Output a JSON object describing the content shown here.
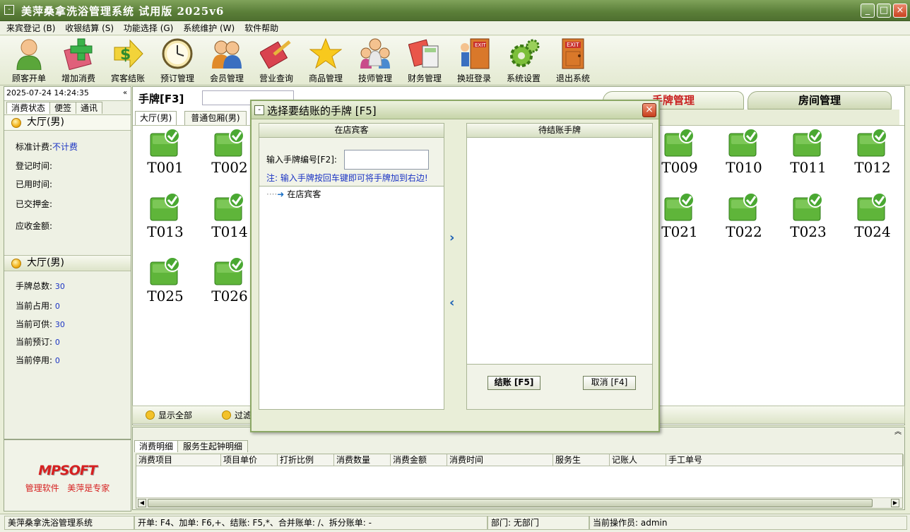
{
  "window": {
    "title": "美萍桑拿洗浴管理系统 试用版 2025v6",
    "buttons": [
      "_",
      "□",
      "×"
    ]
  },
  "menu": [
    "来宾登记 (B)",
    "收银结算 (S)",
    "功能选择 (G)",
    "系统维护 (W)",
    "软件帮助"
  ],
  "toolbar": [
    {
      "label": "顾客开单",
      "icon": "person-icon"
    },
    {
      "label": "增加消费",
      "icon": "add-gift-icon"
    },
    {
      "label": "宾客结账",
      "icon": "dollar-arrow-icon"
    },
    {
      "label": "预订管理",
      "icon": "clock-icon"
    },
    {
      "label": "会员管理",
      "icon": "members-icon"
    },
    {
      "label": "营业查询",
      "icon": "search-book-icon"
    },
    {
      "label": "商品管理",
      "icon": "star-icon"
    },
    {
      "label": "技师管理",
      "icon": "staff-icon"
    },
    {
      "label": "财务管理",
      "icon": "calculator-icon"
    },
    {
      "label": "换班登录",
      "icon": "exit-door-person-icon"
    },
    {
      "label": "系统设置",
      "icon": "gear-icon"
    },
    {
      "label": "退出系统",
      "icon": "exit-door-icon"
    }
  ],
  "left": {
    "datetime": "2025-07-24 14:24:35",
    "collapse": "«",
    "tabs": [
      "消费状态",
      "便签",
      "通讯"
    ],
    "section1": {
      "title": "大厅(男)",
      "rows": [
        {
          "label": "标准计费:",
          "value": "不计费"
        },
        {
          "label": "登记时间:",
          "value": ""
        },
        {
          "label": "已用时间:",
          "value": ""
        },
        {
          "label": "已交押金:",
          "value": ""
        },
        {
          "label": "应收金额:",
          "value": ""
        }
      ]
    },
    "section2": {
      "title": "大厅(男)",
      "rows": [
        {
          "label": "手牌总数:",
          "value": "30"
        },
        {
          "label": "当前占用:",
          "value": "0"
        },
        {
          "label": "当前可供:",
          "value": "30"
        },
        {
          "label": "当前预订:",
          "value": "0"
        },
        {
          "label": "当前停用:",
          "value": "0"
        }
      ]
    },
    "logo": "MPSOFT",
    "slogan1": "管理软件",
    "slogan2": "美萍是专家"
  },
  "main": {
    "tag_label": "手牌[F3]",
    "tabs": [
      "大厅(男)",
      "普通包厢(男)"
    ],
    "right_tabs": [
      "手牌管理",
      "房间管理"
    ],
    "tags_left": [
      "T001",
      "T002",
      "T013",
      "T014",
      "T025",
      "T026"
    ],
    "tags_right": [
      "T009",
      "T010",
      "T011",
      "T012",
      "T021",
      "T022",
      "T023",
      "T024"
    ],
    "bottom_show_all": "显示全部",
    "bottom_filter": "过滤"
  },
  "detail": {
    "tabs": [
      "消费明细",
      "服务生起钟明细"
    ],
    "columns": [
      "消费项目",
      "项目单价",
      "打折比例",
      "消费数量",
      "消费金额",
      "消费时间",
      "服务生",
      "记账人",
      "手工单号"
    ]
  },
  "status": {
    "app": "美萍桑拿洗浴管理系统",
    "shortcuts": "开单: F4、加单: F6,+、结账: F5,*、合并账单: /、拆分账单: -",
    "dept": "部门: 无部门",
    "operator": "当前操作员: admin"
  },
  "dialog": {
    "title": "选择要结账的手牌 [F5]",
    "left_header": "在店宾客",
    "input_label": "输入手牌编号[F2]:",
    "input_value": "",
    "note": "注: 输入手牌按回车键即可将手牌加到右边!",
    "tree_item": "在店宾客",
    "right_header": "待结账手牌",
    "checkout_button": "结账 [F5]",
    "cancel_button": "取消 [F4]"
  }
}
